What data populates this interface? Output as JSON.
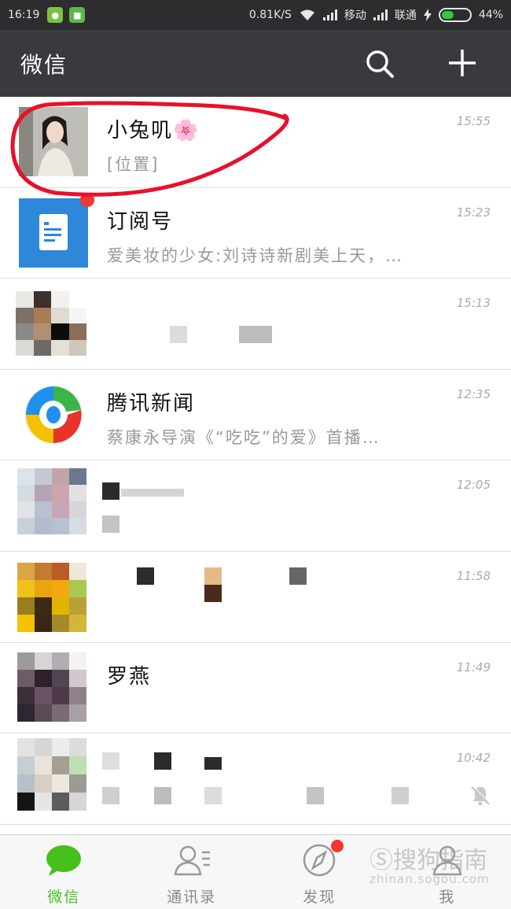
{
  "status_bar": {
    "time": "16:19",
    "network_speed": "0.81K/S",
    "carrier1": "移动",
    "carrier2": "联通",
    "battery": "44%",
    "battery_level": 0.44
  },
  "header": {
    "title": "微信",
    "search_icon": "search-icon",
    "add_icon": "plus-icon"
  },
  "chats": [
    {
      "name": "小兔叽🌸",
      "preview": "[位置]",
      "time": "15:55"
    },
    {
      "name": "订阅号",
      "preview": "爱美妆的少女:刘诗诗新剧美上天，…",
      "time": "15:23"
    },
    {
      "name": "",
      "preview": "",
      "time": "15:13"
    },
    {
      "name": "腾讯新闻",
      "preview": "蔡康永导演《“吃吃”的爱》首播…",
      "time": "12:35"
    },
    {
      "name": "",
      "preview": "",
      "time": "12:05"
    },
    {
      "name": "",
      "preview": "",
      "time": "11:58"
    },
    {
      "name": "罗燕",
      "preview": "",
      "time": "11:49"
    },
    {
      "name": "",
      "preview": "",
      "time": "10:42"
    }
  ],
  "tabs": [
    {
      "label": "微信",
      "icon": "chat-bubble-icon"
    },
    {
      "label": "通讯录",
      "icon": "contacts-icon"
    },
    {
      "label": "发现",
      "icon": "compass-icon"
    },
    {
      "label": "我",
      "icon": "person-icon"
    }
  ],
  "colors": {
    "accent": "#45c01a",
    "header_bg": "#393a3f",
    "badge": "#f43530",
    "annotation": "#e8102a"
  }
}
